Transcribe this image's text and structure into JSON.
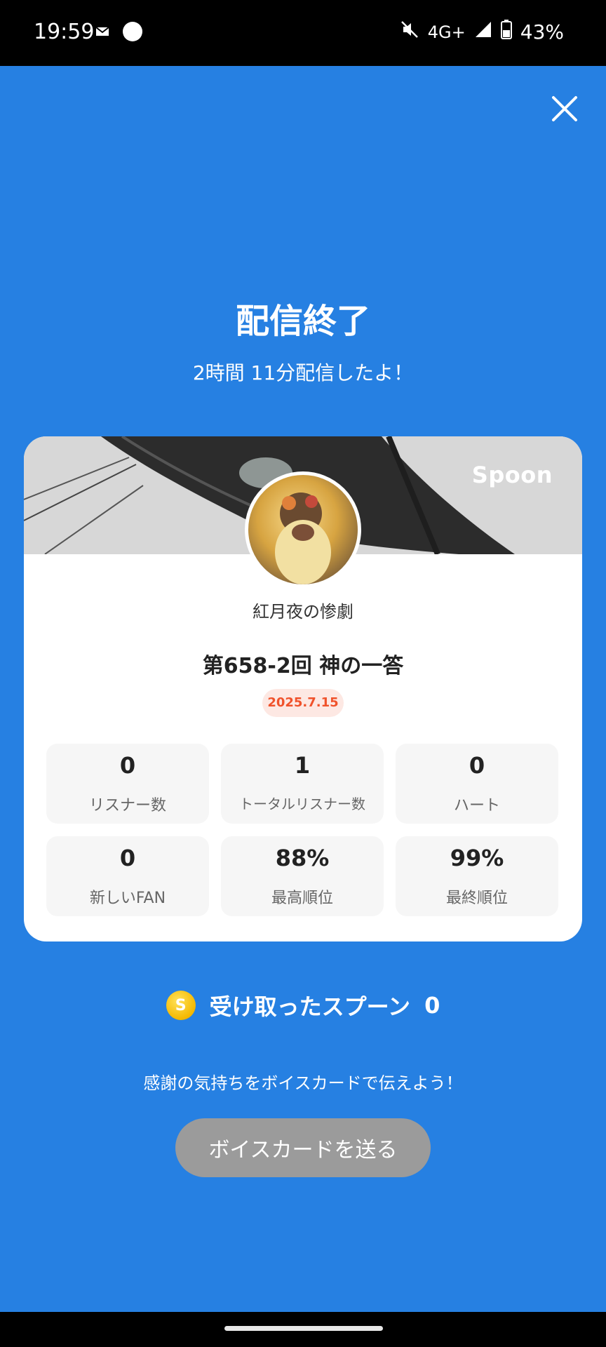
{
  "status_bar": {
    "time": "19:59",
    "network": "4G+",
    "battery": "43%",
    "icons": [
      "notification-mail-icon",
      "circle-dot-icon",
      "mute-icon",
      "signal-icon",
      "battery-icon"
    ]
  },
  "header": {
    "close_icon": "close-icon",
    "title": "配信終了",
    "subtitle": "2時間 11分配信したよ！"
  },
  "card": {
    "brand": "Spoon",
    "username": "紅月夜の惨劇",
    "broadcast_title": "第658-2回 神の一答",
    "date": "2025.7.15",
    "stats": [
      {
        "value": "0",
        "label": "リスナー数"
      },
      {
        "value": "1",
        "label": "トータルリスナー数"
      },
      {
        "value": "0",
        "label": "ハート"
      },
      {
        "value": "0",
        "label": "新しいFAN"
      },
      {
        "value": "88%",
        "label": "最高順位"
      },
      {
        "value": "99%",
        "label": "最終順位"
      }
    ]
  },
  "spoons": {
    "icon_letter": "S",
    "label": "受け取ったスプーン",
    "count": "0"
  },
  "thanks_text": "感謝の気持ちをボイスカードで伝えよう！",
  "voice_card_button": "ボイスカードを送る",
  "colors": {
    "background": "#2680e2",
    "date_badge_text": "#f0522b",
    "button_disabled": "#9b9b9b"
  }
}
